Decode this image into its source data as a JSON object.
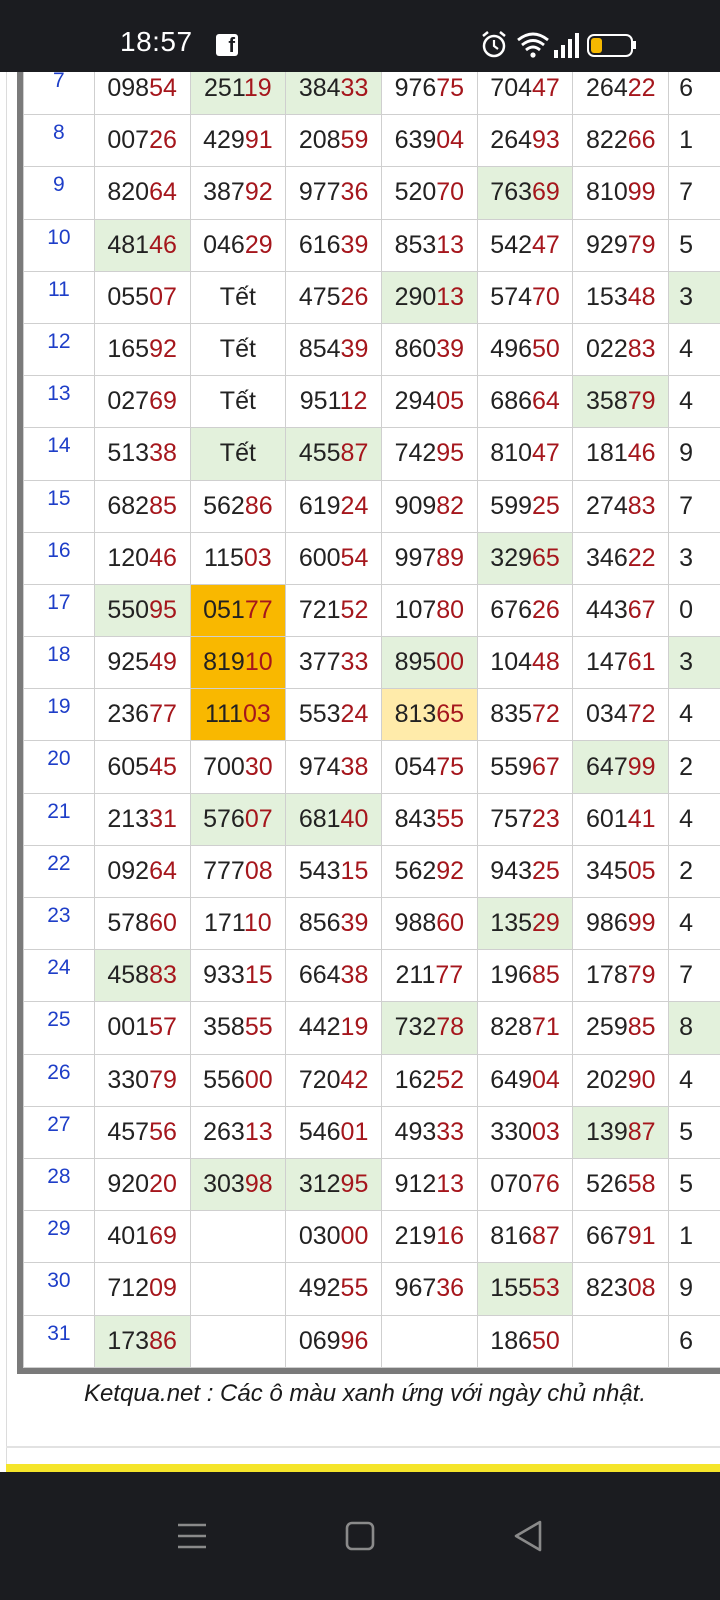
{
  "status_bar": {
    "time": "18:57",
    "fb_icon": "facebook-icon",
    "icons": [
      "alarm-icon",
      "wifi-icon",
      "signal-icon",
      "battery-low-icon"
    ]
  },
  "table": {
    "rows": [
      {
        "day": "7",
        "cells": [
          {
            "h": "098",
            "t": "54"
          },
          {
            "h": "251",
            "t": "19",
            "bg": "sunday"
          },
          {
            "h": "384",
            "t": "33",
            "bg": "sunday"
          },
          {
            "h": "976",
            "t": "75"
          },
          {
            "h": "704",
            "t": "47"
          },
          {
            "h": "264",
            "t": "22"
          },
          {
            "h": "6",
            "t": ""
          }
        ]
      },
      {
        "day": "8",
        "cells": [
          {
            "h": "007",
            "t": "26"
          },
          {
            "h": "429",
            "t": "91"
          },
          {
            "h": "208",
            "t": "59"
          },
          {
            "h": "639",
            "t": "04"
          },
          {
            "h": "264",
            "t": "93"
          },
          {
            "h": "822",
            "t": "66"
          },
          {
            "h": "1",
            "t": ""
          }
        ]
      },
      {
        "day": "9",
        "cells": [
          {
            "h": "820",
            "t": "64"
          },
          {
            "h": "387",
            "t": "92"
          },
          {
            "h": "977",
            "t": "36"
          },
          {
            "h": "520",
            "t": "70"
          },
          {
            "h": "763",
            "t": "69",
            "bg": "sunday"
          },
          {
            "h": "810",
            "t": "99"
          },
          {
            "h": "7",
            "t": ""
          }
        ]
      },
      {
        "day": "10",
        "cells": [
          {
            "h": "481",
            "t": "46",
            "bg": "sunday"
          },
          {
            "h": "046",
            "t": "29"
          },
          {
            "h": "616",
            "t": "39"
          },
          {
            "h": "853",
            "t": "13"
          },
          {
            "h": "542",
            "t": "47"
          },
          {
            "h": "929",
            "t": "79"
          },
          {
            "h": "5",
            "t": ""
          }
        ]
      },
      {
        "day": "11",
        "cells": [
          {
            "h": "055",
            "t": "07"
          },
          {
            "h": "Tết",
            "t": ""
          },
          {
            "h": "475",
            "t": "26"
          },
          {
            "h": "290",
            "t": "13",
            "bg": "sunday"
          },
          {
            "h": "574",
            "t": "70"
          },
          {
            "h": "153",
            "t": "48"
          },
          {
            "h": "3",
            "t": "",
            "bg": "sunday"
          }
        ]
      },
      {
        "day": "12",
        "cells": [
          {
            "h": "165",
            "t": "92"
          },
          {
            "h": "Tết",
            "t": ""
          },
          {
            "h": "854",
            "t": "39"
          },
          {
            "h": "860",
            "t": "39"
          },
          {
            "h": "496",
            "t": "50"
          },
          {
            "h": "022",
            "t": "83"
          },
          {
            "h": "4",
            "t": ""
          }
        ]
      },
      {
        "day": "13",
        "cells": [
          {
            "h": "027",
            "t": "69"
          },
          {
            "h": "Tết",
            "t": ""
          },
          {
            "h": "951",
            "t": "12"
          },
          {
            "h": "294",
            "t": "05"
          },
          {
            "h": "686",
            "t": "64"
          },
          {
            "h": "358",
            "t": "79",
            "bg": "sunday"
          },
          {
            "h": "4",
            "t": ""
          }
        ]
      },
      {
        "day": "14",
        "cells": [
          {
            "h": "513",
            "t": "38"
          },
          {
            "h": "Tết",
            "t": "",
            "bg": "sunday"
          },
          {
            "h": "455",
            "t": "87",
            "bg": "sunday"
          },
          {
            "h": "742",
            "t": "95"
          },
          {
            "h": "810",
            "t": "47"
          },
          {
            "h": "181",
            "t": "46"
          },
          {
            "h": "9",
            "t": ""
          }
        ]
      },
      {
        "day": "15",
        "cells": [
          {
            "h": "682",
            "t": "85"
          },
          {
            "h": "562",
            "t": "86"
          },
          {
            "h": "619",
            "t": "24"
          },
          {
            "h": "909",
            "t": "82"
          },
          {
            "h": "599",
            "t": "25"
          },
          {
            "h": "274",
            "t": "83"
          },
          {
            "h": "7",
            "t": ""
          }
        ]
      },
      {
        "day": "16",
        "cells": [
          {
            "h": "120",
            "t": "46"
          },
          {
            "h": "115",
            "t": "03"
          },
          {
            "h": "600",
            "t": "54"
          },
          {
            "h": "997",
            "t": "89"
          },
          {
            "h": "329",
            "t": "65",
            "bg": "sunday"
          },
          {
            "h": "346",
            "t": "22"
          },
          {
            "h": "3",
            "t": ""
          }
        ]
      },
      {
        "day": "17",
        "cells": [
          {
            "h": "550",
            "t": "95",
            "bg": "sunday"
          },
          {
            "h": "051",
            "t": "77",
            "bg": "orange"
          },
          {
            "h": "721",
            "t": "52"
          },
          {
            "h": "107",
            "t": "80"
          },
          {
            "h": "676",
            "t": "26"
          },
          {
            "h": "443",
            "t": "67"
          },
          {
            "h": "0",
            "t": ""
          }
        ]
      },
      {
        "day": "18",
        "cells": [
          {
            "h": "925",
            "t": "49"
          },
          {
            "h": "819",
            "t": "10",
            "bg": "orange"
          },
          {
            "h": "377",
            "t": "33"
          },
          {
            "h": "895",
            "t": "00",
            "bg": "sunday"
          },
          {
            "h": "104",
            "t": "48"
          },
          {
            "h": "147",
            "t": "61"
          },
          {
            "h": "3",
            "t": "",
            "bg": "sunday"
          }
        ]
      },
      {
        "day": "19",
        "cells": [
          {
            "h": "236",
            "t": "77"
          },
          {
            "h": "111",
            "t": "03",
            "bg": "orange"
          },
          {
            "h": "553",
            "t": "24"
          },
          {
            "h": "813",
            "t": "65",
            "bg": "lightorange"
          },
          {
            "h": "835",
            "t": "72"
          },
          {
            "h": "034",
            "t": "72"
          },
          {
            "h": "4",
            "t": ""
          }
        ]
      },
      {
        "day": "20",
        "cells": [
          {
            "h": "605",
            "t": "45"
          },
          {
            "h": "700",
            "t": "30"
          },
          {
            "h": "974",
            "t": "38"
          },
          {
            "h": "054",
            "t": "75"
          },
          {
            "h": "559",
            "t": "67"
          },
          {
            "h": "647",
            "t": "99",
            "bg": "sunday"
          },
          {
            "h": "2",
            "t": ""
          }
        ]
      },
      {
        "day": "21",
        "cells": [
          {
            "h": "213",
            "t": "31"
          },
          {
            "h": "576",
            "t": "07",
            "bg": "sunday"
          },
          {
            "h": "681",
            "t": "40",
            "bg": "sunday"
          },
          {
            "h": "843",
            "t": "55"
          },
          {
            "h": "757",
            "t": "23"
          },
          {
            "h": "601",
            "t": "41"
          },
          {
            "h": "4",
            "t": ""
          }
        ]
      },
      {
        "day": "22",
        "cells": [
          {
            "h": "092",
            "t": "64"
          },
          {
            "h": "777",
            "t": "08"
          },
          {
            "h": "543",
            "t": "15"
          },
          {
            "h": "562",
            "t": "92"
          },
          {
            "h": "943",
            "t": "25"
          },
          {
            "h": "345",
            "t": "05"
          },
          {
            "h": "2",
            "t": ""
          }
        ]
      },
      {
        "day": "23",
        "cells": [
          {
            "h": "578",
            "t": "60"
          },
          {
            "h": "171",
            "t": "10"
          },
          {
            "h": "856",
            "t": "39"
          },
          {
            "h": "988",
            "t": "60"
          },
          {
            "h": "135",
            "t": "29",
            "bg": "sunday"
          },
          {
            "h": "986",
            "t": "99"
          },
          {
            "h": "4",
            "t": ""
          }
        ]
      },
      {
        "day": "24",
        "cells": [
          {
            "h": "458",
            "t": "83",
            "bg": "sunday"
          },
          {
            "h": "933",
            "t": "15"
          },
          {
            "h": "664",
            "t": "38"
          },
          {
            "h": "211",
            "t": "77"
          },
          {
            "h": "196",
            "t": "85"
          },
          {
            "h": "178",
            "t": "79"
          },
          {
            "h": "7",
            "t": ""
          }
        ]
      },
      {
        "day": "25",
        "cells": [
          {
            "h": "001",
            "t": "57"
          },
          {
            "h": "358",
            "t": "55"
          },
          {
            "h": "442",
            "t": "19"
          },
          {
            "h": "732",
            "t": "78",
            "bg": "sunday"
          },
          {
            "h": "828",
            "t": "71"
          },
          {
            "h": "259",
            "t": "85"
          },
          {
            "h": "8",
            "t": "",
            "bg": "sunday"
          }
        ]
      },
      {
        "day": "26",
        "cells": [
          {
            "h": "330",
            "t": "79"
          },
          {
            "h": "556",
            "t": "00"
          },
          {
            "h": "720",
            "t": "42"
          },
          {
            "h": "162",
            "t": "52"
          },
          {
            "h": "649",
            "t": "04"
          },
          {
            "h": "202",
            "t": "90"
          },
          {
            "h": "4",
            "t": ""
          }
        ]
      },
      {
        "day": "27",
        "cells": [
          {
            "h": "457",
            "t": "56"
          },
          {
            "h": "263",
            "t": "13"
          },
          {
            "h": "546",
            "t": "01"
          },
          {
            "h": "493",
            "t": "33"
          },
          {
            "h": "330",
            "t": "03"
          },
          {
            "h": "139",
            "t": "87",
            "bg": "sunday"
          },
          {
            "h": "5",
            "t": ""
          }
        ]
      },
      {
        "day": "28",
        "cells": [
          {
            "h": "920",
            "t": "20"
          },
          {
            "h": "303",
            "t": "98",
            "bg": "sunday"
          },
          {
            "h": "312",
            "t": "95",
            "bg": "sunday"
          },
          {
            "h": "912",
            "t": "13"
          },
          {
            "h": "070",
            "t": "76"
          },
          {
            "h": "526",
            "t": "58"
          },
          {
            "h": "5",
            "t": ""
          }
        ]
      },
      {
        "day": "29",
        "cells": [
          {
            "h": "401",
            "t": "69"
          },
          {
            "h": "",
            "t": ""
          },
          {
            "h": "030",
            "t": "00"
          },
          {
            "h": "219",
            "t": "16"
          },
          {
            "h": "816",
            "t": "87"
          },
          {
            "h": "667",
            "t": "91"
          },
          {
            "h": "1",
            "t": ""
          }
        ]
      },
      {
        "day": "30",
        "cells": [
          {
            "h": "712",
            "t": "09"
          },
          {
            "h": "",
            "t": ""
          },
          {
            "h": "492",
            "t": "55"
          },
          {
            "h": "967",
            "t": "36"
          },
          {
            "h": "155",
            "t": "53",
            "bg": "sunday"
          },
          {
            "h": "823",
            "t": "08"
          },
          {
            "h": "9",
            "t": ""
          }
        ]
      },
      {
        "day": "31",
        "cells": [
          {
            "h": "173",
            "t": "86",
            "bg": "sunday"
          },
          {
            "h": "",
            "t": ""
          },
          {
            "h": "069",
            "t": "96"
          },
          {
            "h": "",
            "t": ""
          },
          {
            "h": "186",
            "t": "50"
          },
          {
            "h": "",
            "t": ""
          },
          {
            "h": "6",
            "t": ""
          }
        ]
      }
    ]
  },
  "note": "Ketqua.net : Các ô màu xanh ứng với ngày chủ nhật.",
  "colors": {
    "sunday": "#e3f1dc",
    "orange": "#f9b800",
    "lightorange": "#ffebaa",
    "tail": "#a5161c",
    "day": "#1e3ec8"
  },
  "nav_bar": {
    "buttons": [
      "menu-icon",
      "home-square-icon",
      "back-triangle-icon"
    ]
  }
}
